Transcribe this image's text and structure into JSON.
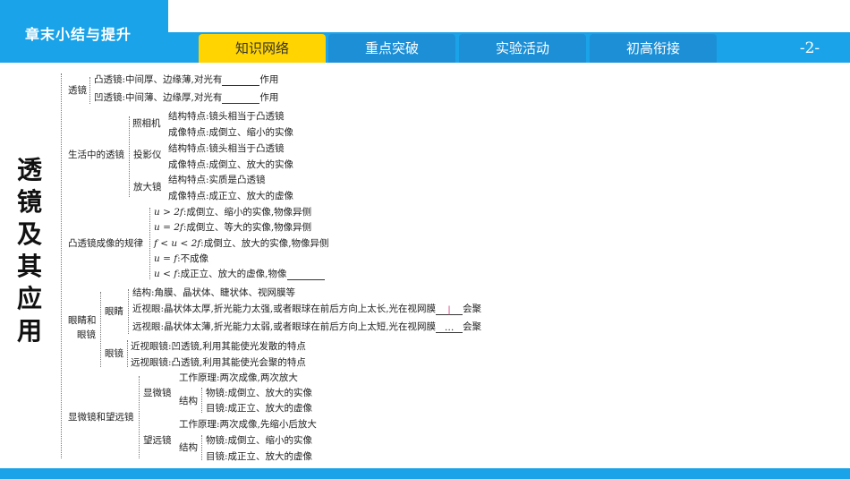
{
  "header": {
    "chapter_title": "章末小结与提升",
    "tabs": [
      {
        "label": "知识网络",
        "active": true
      },
      {
        "label": "重点突破",
        "active": false
      },
      {
        "label": "实验活动",
        "active": false
      },
      {
        "label": "初高衔接",
        "active": false
      }
    ],
    "page_number": "-2-"
  },
  "side_title": [
    "透",
    "镜",
    "及",
    "其",
    "应",
    "用"
  ],
  "tree": {
    "lens": {
      "label": "透镜",
      "convex": "凸透镜:中间厚、边缘薄,对光有",
      "convex_suffix": "作用",
      "concave": "凹透镜:中间薄、边缘厚,对光有",
      "concave_suffix": "作用"
    },
    "daily": {
      "label": "生活中的透镜",
      "camera": {
        "label": "照相机",
        "feature": "结构特点:镜头相当于凸透镜",
        "image": "成像特点:成倒立、缩小的实像"
      },
      "projector": {
        "label": "投影仪",
        "feature": "结构特点:镜头相当于凸透镜",
        "image": "成像特点:成倒立、放大的实像"
      },
      "magnifier": {
        "label": "放大镜",
        "feature": "结构特点:实质是凸透镜",
        "image": "成像特点:成正立、放大的虚像"
      }
    },
    "rules": {
      "label": "凸透镜成像的规律",
      "items": [
        {
          "cond": "u > 2f",
          "text": ":成倒立、缩小的实像,物像异侧"
        },
        {
          "cond": "u = 2f",
          "text": ":成倒立、等大的实像,物像异侧"
        },
        {
          "cond": "f < u < 2f",
          "text": ":成倒立、放大的实像,物像异侧"
        },
        {
          "cond": "u = f",
          "text": ":不成像"
        },
        {
          "cond": "u < f",
          "text": ":成正立、放大的虚像,物像"
        }
      ]
    },
    "eyes": {
      "label_line1": "眼睛和",
      "label_line2": "眼镜",
      "eye_label": "眼睛",
      "structure": "结构:角膜、晶状体、睫状体、视网膜等",
      "myopia": "近视眼:晶状体太厚,折光能力太强,或者眼球在前后方向上太长,光在视网膜",
      "myopia_blank": "|",
      "myopia_suffix": "会聚",
      "hyperopia": "远视眼:晶状体太薄,折光能力太弱,或者眼球在前后方向上太短,光在视网膜",
      "hyperopia_blank": "…",
      "hyperopia_suffix": "会聚",
      "glasses_label": "眼镜",
      "myopia_glasses": "近视眼镜:凹透镜,利用其能使光发散的特点",
      "hyperopia_glasses": "远视眼镜:凸透镜,利用其能使光会聚的特点"
    },
    "scopes": {
      "label": "显微镜和望远镜",
      "microscope": {
        "label": "显微镜",
        "principle": "工作原理:两次成像,两次放大",
        "structure_label": "结构",
        "objective": "物镜:成倒立、放大的实像",
        "eyepiece": "目镜:成正立、放大的虚像"
      },
      "telescope": {
        "label": "望远镜",
        "principle": "工作原理:两次成像,先缩小后放大",
        "structure_label": "结构",
        "objective": "物镜:成倒立、缩小的实像",
        "eyepiece": "目镜:成正立、放大的虚像"
      }
    }
  }
}
